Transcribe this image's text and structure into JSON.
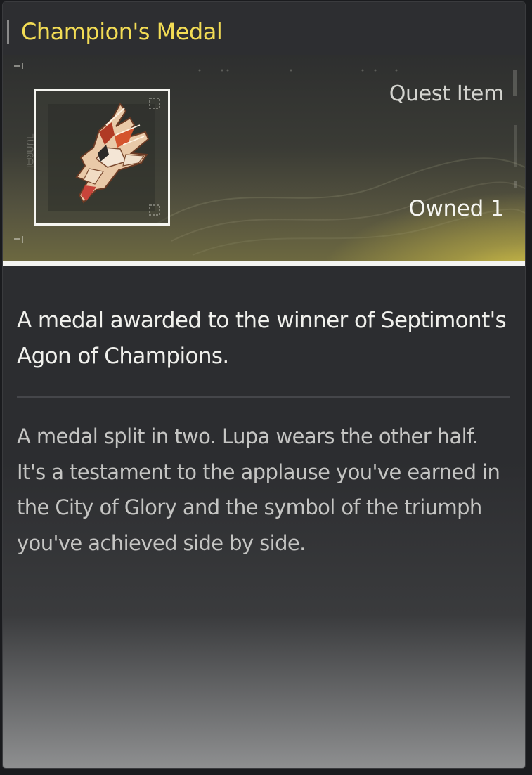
{
  "item": {
    "name": "Champion's Medal",
    "type": "Quest Item",
    "owned_label": "Owned",
    "owned_count": "1",
    "icon": "champions-medal-icon",
    "icon_side_text": "ᒣᑌᑎᖇᗩᒪ"
  },
  "summary": "A medal awarded to the winner of Septimont's Agon of Champions.",
  "description": [
    "A medal split in two. Lupa wears the other half.",
    "It's a testament to the applause you've earned in the City of Glory and the symbol of the triumph you've achieved side by side."
  ],
  "colors": {
    "title": "#f2dc55",
    "panel_bg": "#2c2d30",
    "hero_glow": "#ecd848",
    "summary_text": "#f0f0ec",
    "description_text": "#c5c5c3"
  }
}
